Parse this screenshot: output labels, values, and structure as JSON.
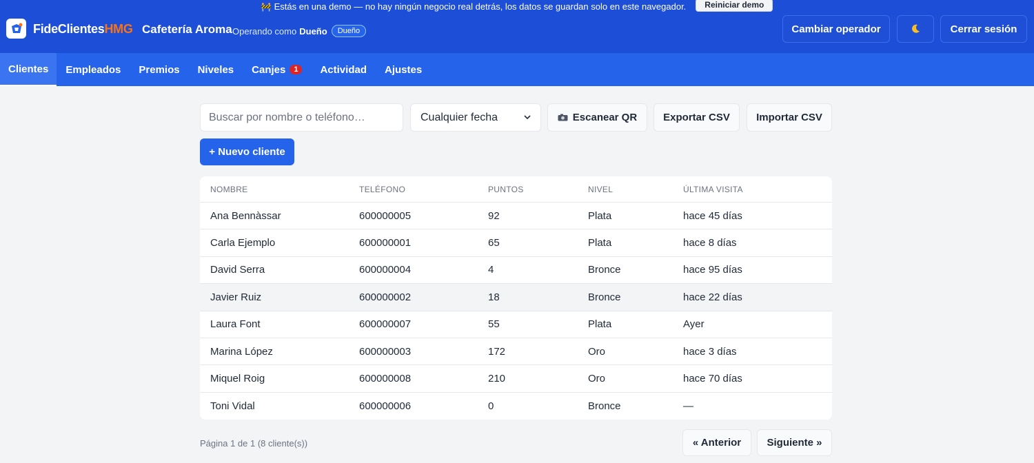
{
  "demo_banner": {
    "text": "Estás en una demo — no hay ningún negocio real detrás, los datos se guardan solo en este navegador.",
    "reset_label": "Reiniciar demo"
  },
  "header": {
    "brand_main": "FideClientes",
    "brand_accent": "HMG",
    "business_name": "Cafetería Aroma",
    "operating_label": "Operando como",
    "operator_name": "Dueño",
    "role_badge": "Dueño",
    "switch_operator_label": "Cambiar operador",
    "theme_icon": "moon-icon",
    "logout_label": "Cerrar sesión"
  },
  "nav": {
    "items": [
      {
        "label": "Clientes"
      },
      {
        "label": "Empleados"
      },
      {
        "label": "Premios"
      },
      {
        "label": "Niveles"
      },
      {
        "label": "Canjes",
        "badge": "1"
      },
      {
        "label": "Actividad"
      },
      {
        "label": "Ajustes"
      }
    ],
    "active": "Clientes"
  },
  "toolbar": {
    "search_placeholder": "Buscar por nombre o teléfono…",
    "date_filter_value": "Cualquier fecha",
    "scan_qr_label": "Escanear QR",
    "export_label": "Exportar CSV",
    "import_label": "Importar CSV",
    "new_client_label": "+ Nuevo cliente"
  },
  "table": {
    "headers": [
      "Nombre",
      "Teléfono",
      "Puntos",
      "Nivel",
      "Última visita"
    ],
    "rows": [
      [
        "Ana Bennàssar",
        "600000005",
        "92",
        "Plata",
        "hace 45 días"
      ],
      [
        "Carla Ejemplo",
        "600000001",
        "65",
        "Plata",
        "hace 8 días"
      ],
      [
        "David Serra",
        "600000004",
        "4",
        "Bronce",
        "hace 95 días"
      ],
      [
        "Javier Ruiz",
        "600000002",
        "18",
        "Bronce",
        "hace 22 días"
      ],
      [
        "Laura Font",
        "600000007",
        "55",
        "Plata",
        "Ayer"
      ],
      [
        "Marina López",
        "600000003",
        "172",
        "Oro",
        "hace 3 días"
      ],
      [
        "Miquel Roig",
        "600000008",
        "210",
        "Oro",
        "hace 70 días"
      ],
      [
        "Toni Vidal",
        "600000006",
        "0",
        "Bronce",
        "—"
      ]
    ]
  },
  "pagination": {
    "info": "Página 1 de 1 (8 cliente(s))",
    "prev_label": "« Anterior",
    "next_label": "Siguiente »"
  },
  "colors": {
    "header_bg": "#1d4ed8",
    "nav_bg": "#2563eb",
    "accent": "#f97316",
    "primary_button": "#2563eb",
    "badge_red": "#dc2626"
  }
}
